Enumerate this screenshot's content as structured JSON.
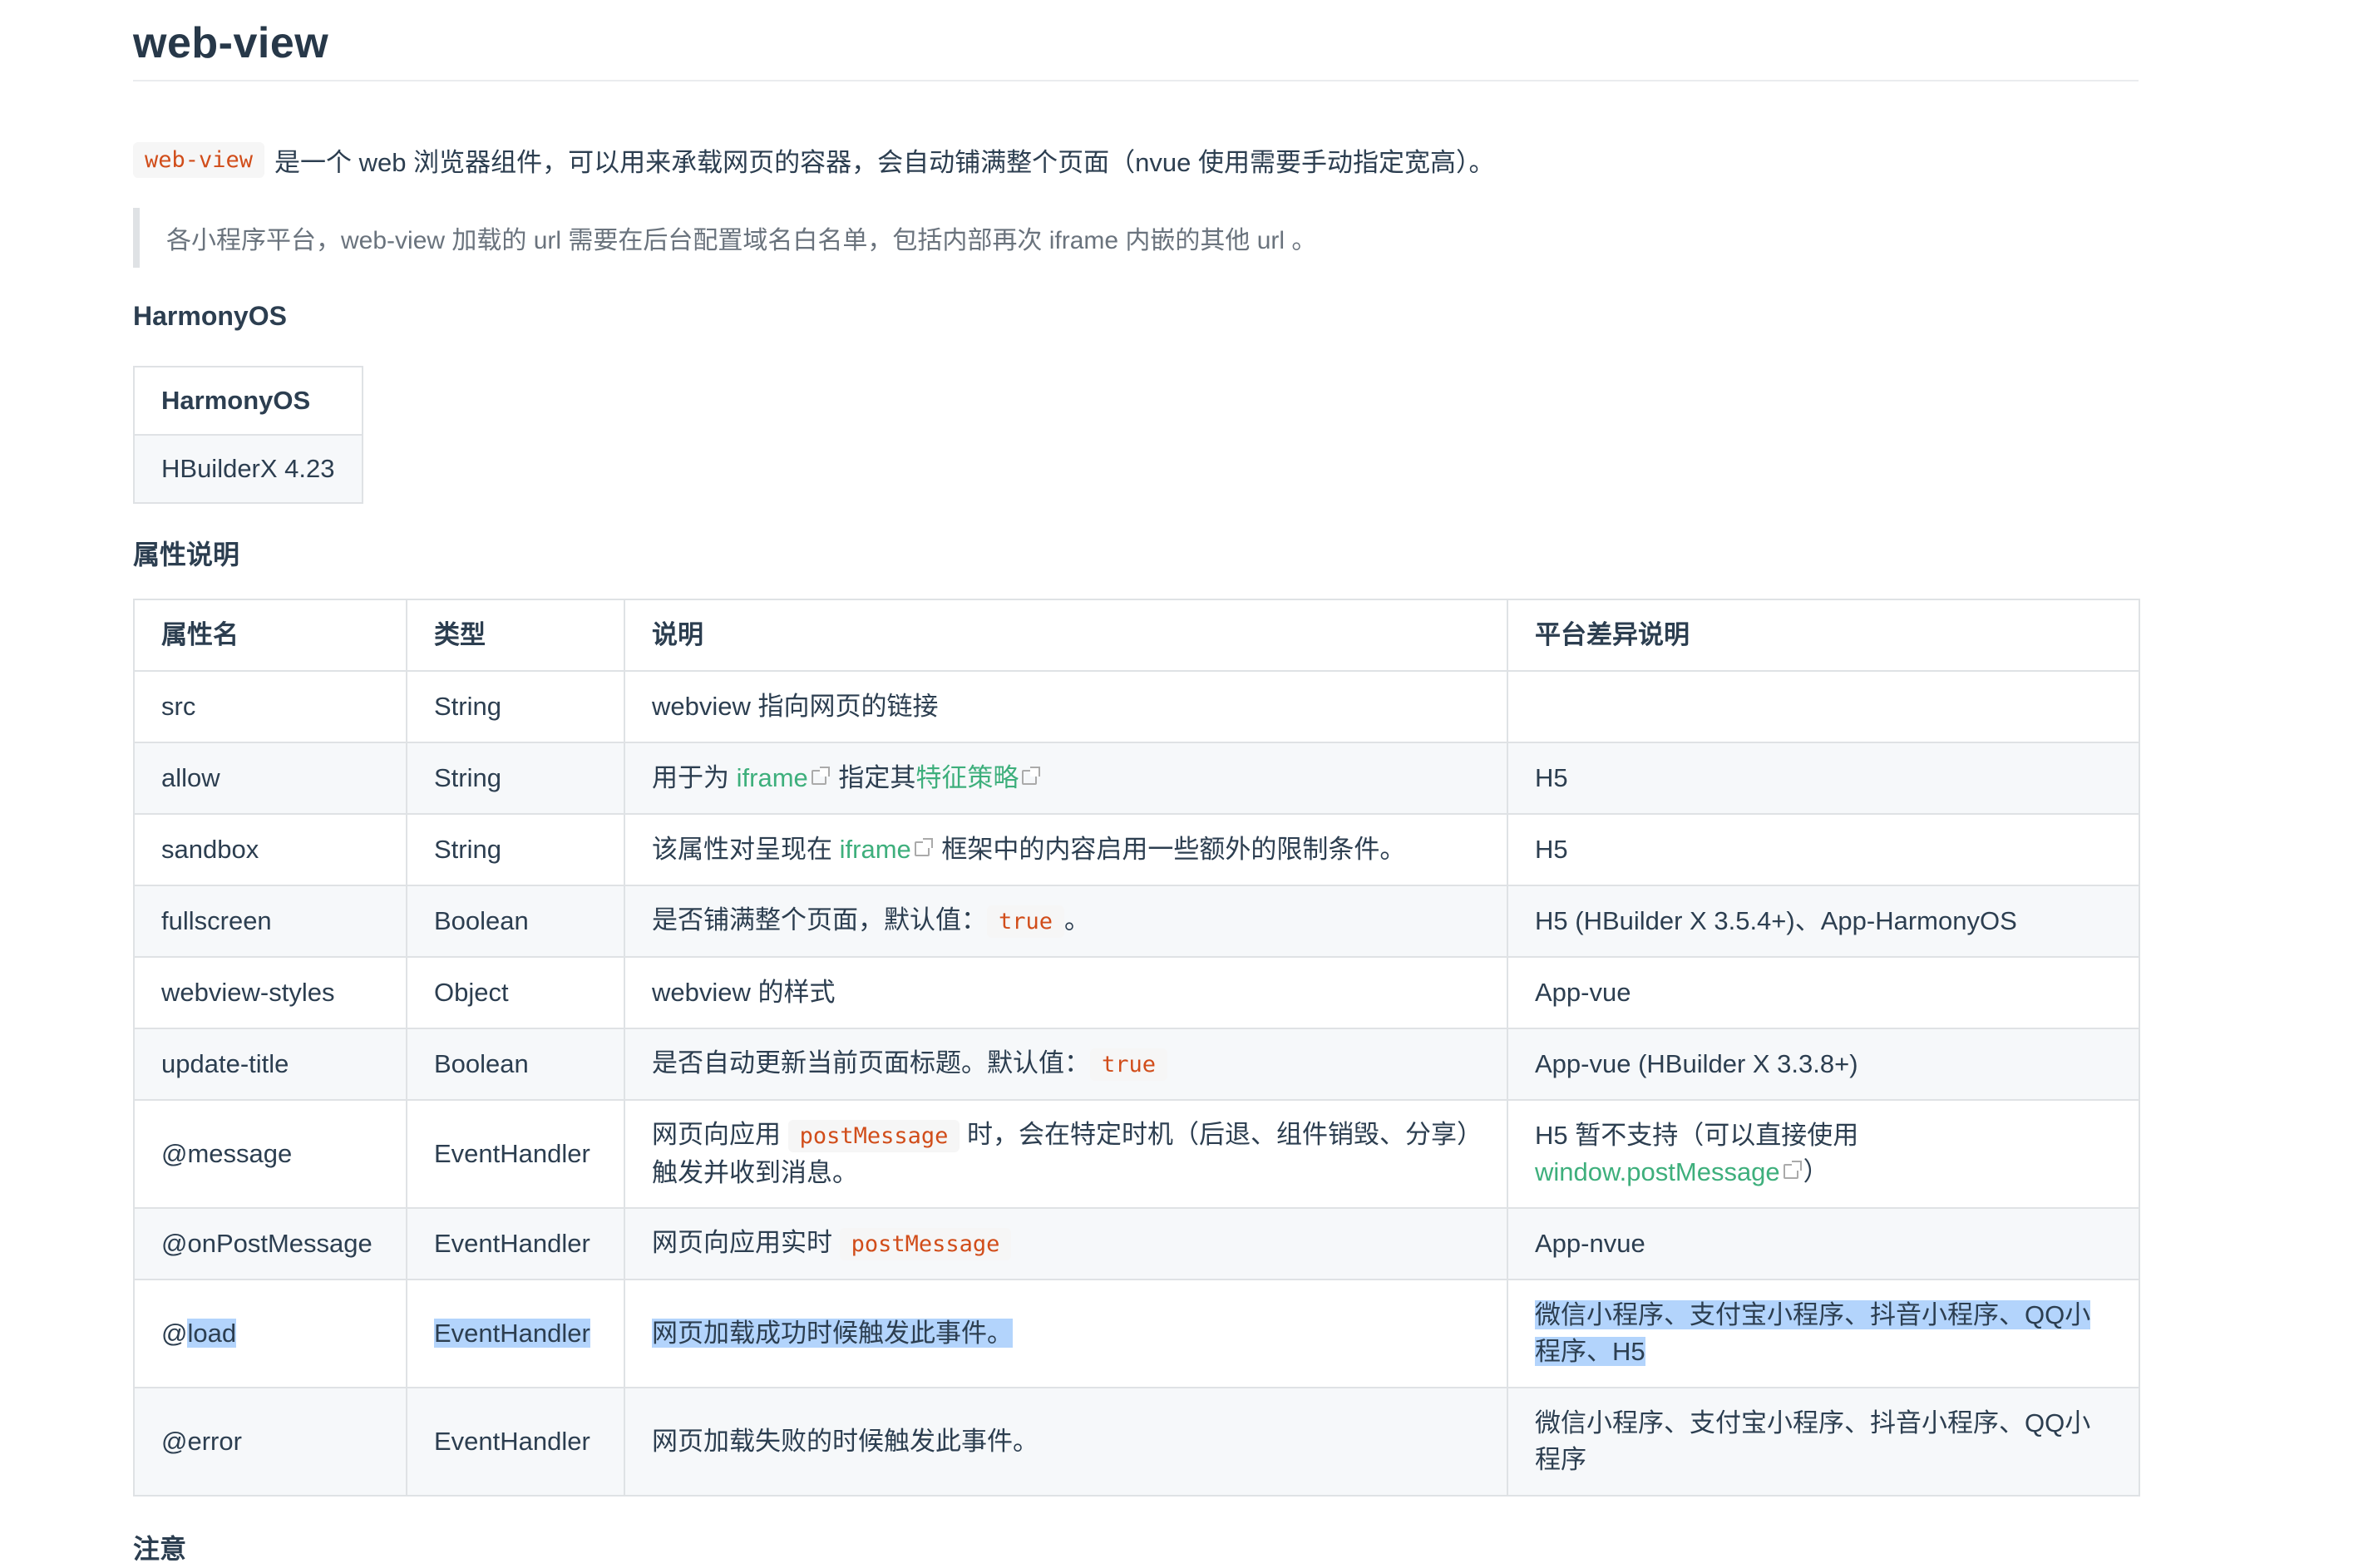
{
  "page": {
    "title": "web-view",
    "intro": {
      "code": "web-view",
      "text": "是一个 web 浏览器组件，可以用来承载网页的容器，会自动铺满整个页面（nvue 使用需要手动指定宽高）。"
    },
    "quote": "各小程序平台，web-view 加载的 url 需要在后台配置域名白名单，包括内部再次 iframe 内嵌的其他 url 。",
    "harmony_heading": "HarmonyOS",
    "harmony_table": {
      "header": "HarmonyOS",
      "value": "HBuilderX 4.23"
    },
    "attr_heading": "属性说明",
    "note_heading": "注意"
  },
  "attrs": {
    "headers": [
      "属性名",
      "类型",
      "说明",
      "平台差异说明"
    ],
    "rows": {
      "src": {
        "name": "src",
        "type": "String",
        "desc": "webview 指向网页的链接",
        "platform": ""
      },
      "allow": {
        "name": "allow",
        "type": "String",
        "desc_pre": "用于为 ",
        "link1": "iframe",
        "desc_mid": " 指定其",
        "link2": "特征策略",
        "platform": "H5"
      },
      "sandbox": {
        "name": "sandbox",
        "type": "String",
        "desc_pre": "该属性对呈现在 ",
        "link1": "iframe",
        "desc_post": " 框架中的内容启用一些额外的限制条件。",
        "platform": "H5"
      },
      "fullscreen": {
        "name": "fullscreen",
        "type": "Boolean",
        "desc_pre": "是否铺满整个页面，默认值：",
        "code": "true",
        "desc_post": "。",
        "platform": "H5 (HBuilder X 3.5.4+)、App-HarmonyOS"
      },
      "webview_styles": {
        "name": "webview-styles",
        "type": "Object",
        "desc": "webview 的样式",
        "platform": "App-vue"
      },
      "update_title": {
        "name": "update-title",
        "type": "Boolean",
        "desc_pre": "是否自动更新当前页面标题。默认值：",
        "code": "true",
        "platform": "App-vue (HBuilder X 3.3.8+)"
      },
      "message": {
        "name": "@message",
        "type": "EventHandler",
        "desc_pre": "网页向应用 ",
        "code": "postMessage",
        "desc_post": " 时，会在特定时机（后退、组件销毁、分享）触发并收到消息。",
        "platform_pre": "H5 暂不支持（可以直接使用 ",
        "platform_link": "window.postMessage",
        "platform_post": "）"
      },
      "on_post_message": {
        "name": "@onPostMessage",
        "type": "EventHandler",
        "desc_pre": "网页向应用实时 ",
        "code": "postMessage",
        "platform": "App-nvue"
      },
      "load": {
        "name_prefix": "@",
        "name_sel": "load",
        "type": "EventHandler",
        "desc": "网页加载成功时候触发此事件。",
        "platform": "微信小程序、支付宝小程序、抖音小程序、QQ小程序、H5"
      },
      "error": {
        "name": "@error",
        "type": "EventHandler",
        "desc": "网页加载失败的时候触发此事件。",
        "platform": "微信小程序、支付宝小程序、抖音小程序、QQ小程序"
      }
    }
  },
  "colors": {
    "link": "#3eaf7c",
    "code": "#d14d1a",
    "selection": "#b3d4fc",
    "border": "#dfe2e5"
  }
}
